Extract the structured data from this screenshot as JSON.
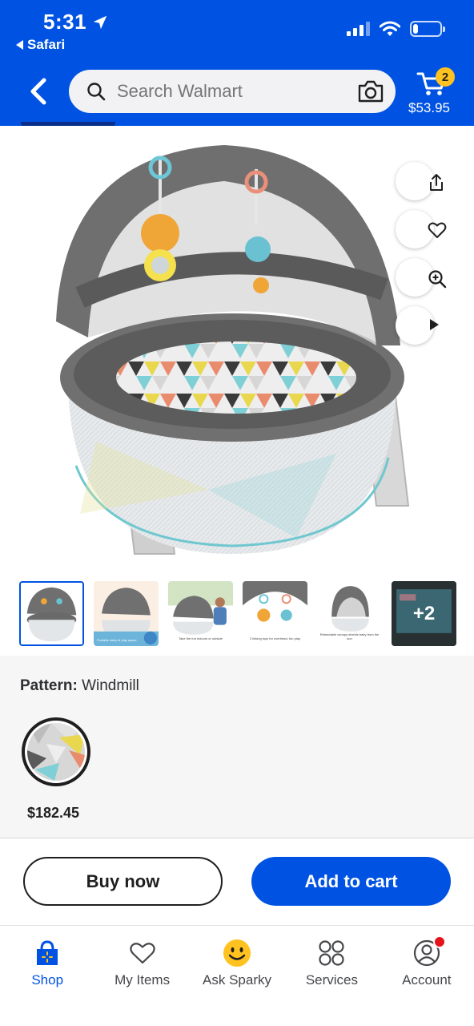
{
  "status_bar": {
    "time": "5:31",
    "back_app": "Safari",
    "battery_percent": 20
  },
  "header": {
    "search_placeholder": "Search Walmart",
    "cart_count": "2",
    "cart_total": "$53.95"
  },
  "thumbnails": [
    {
      "caption": ""
    },
    {
      "caption": "Portable sleep & play space"
    },
    {
      "caption": "Take the fun indoors or outside"
    },
    {
      "caption": "2 linking toys for overhead, fun play"
    },
    {
      "caption": "Retractable canopy shields baby from the sun"
    },
    {
      "caption": "",
      "more_label": "+2"
    }
  ],
  "variant": {
    "label": "Pattern:",
    "value": "Windmill",
    "price": "$182.45"
  },
  "actions": {
    "buy_now": "Buy now",
    "add_to_cart": "Add to cart"
  },
  "bottom_nav": [
    {
      "label": "Shop",
      "icon": "shop-icon",
      "active": true
    },
    {
      "label": "My Items",
      "icon": "heart-icon",
      "active": false
    },
    {
      "label": "Ask Sparky",
      "icon": "sparky-icon",
      "active": false
    },
    {
      "label": "Services",
      "icon": "services-icon",
      "active": false
    },
    {
      "label": "Account",
      "icon": "account-icon",
      "active": false
    }
  ],
  "colors": {
    "brand_blue": "#0053e2",
    "spark_yellow": "#ffc220",
    "notification_red": "#e3141c"
  }
}
